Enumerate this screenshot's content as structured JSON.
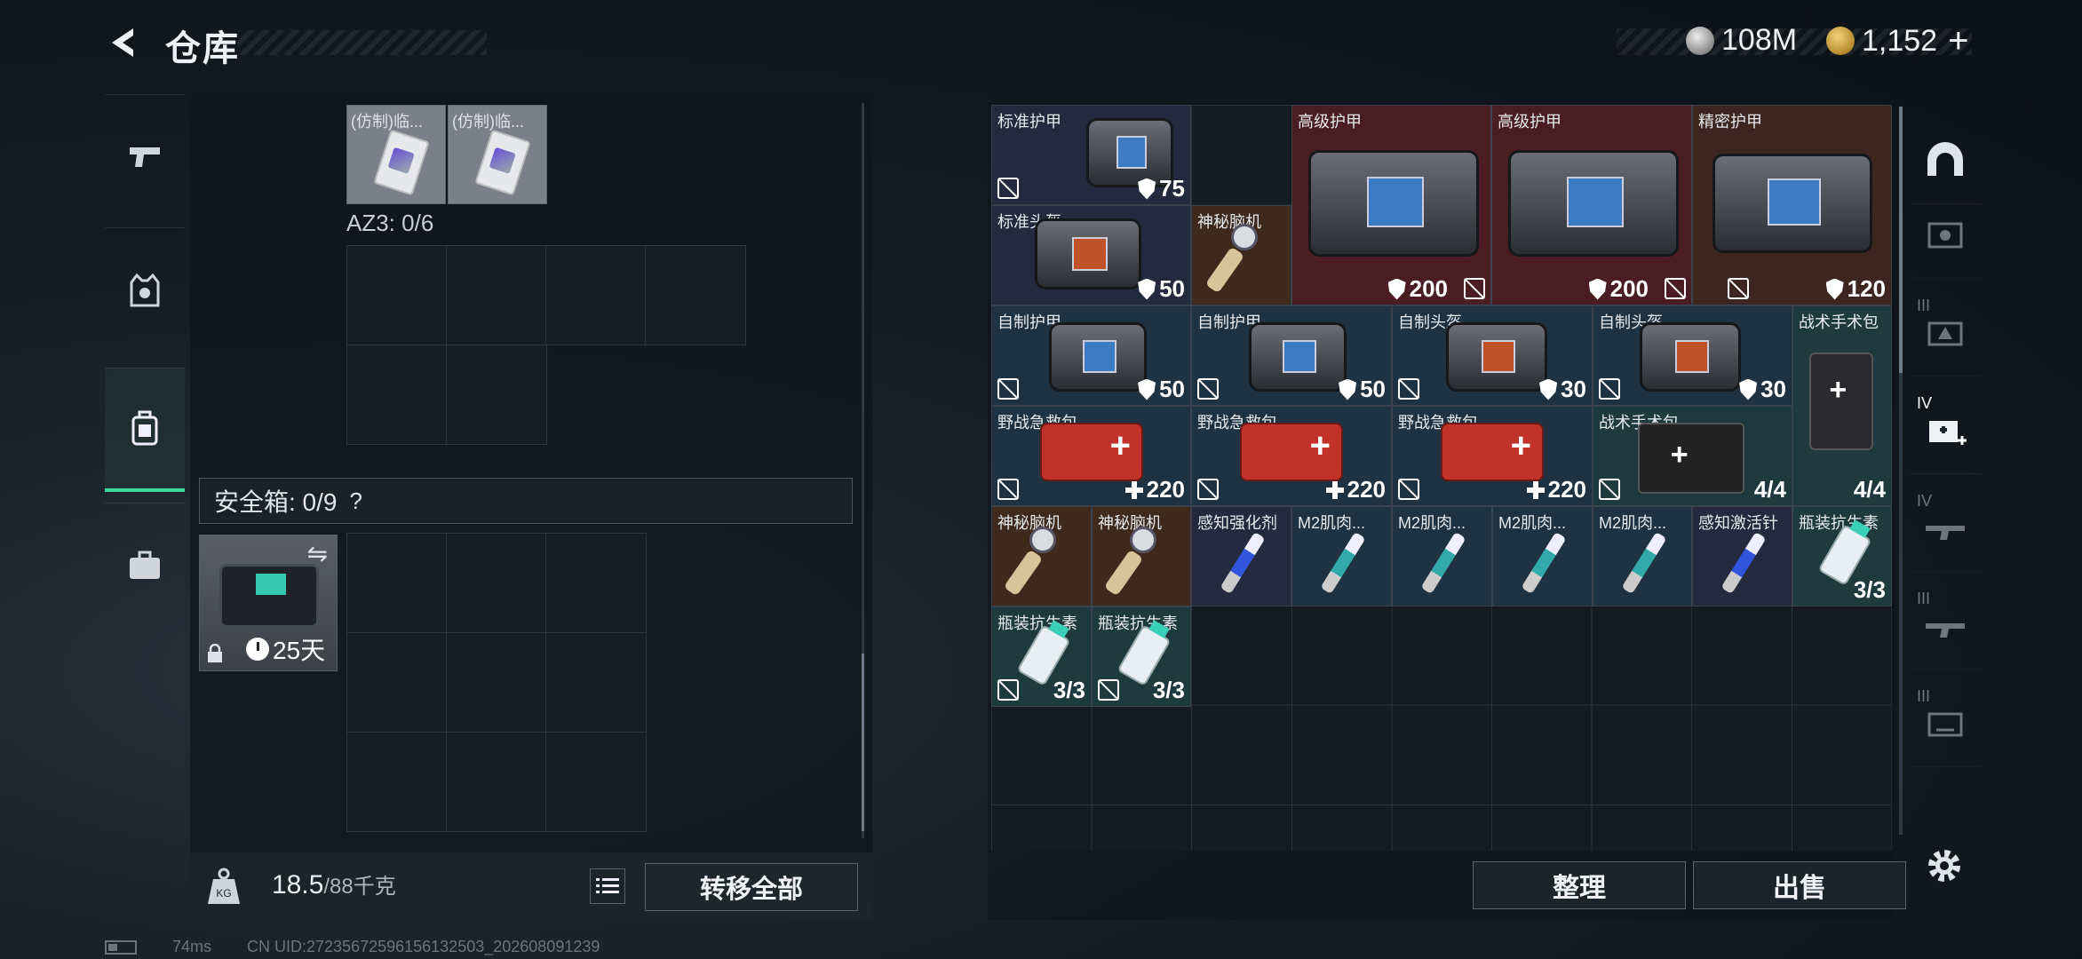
{
  "header": {
    "title": "仓库",
    "currency_silver": "108M",
    "currency_gold": "1,152",
    "add_label": "+"
  },
  "left": {
    "top_items": [
      {
        "name": "(仿制)临..."
      },
      {
        "name": "(仿制)临..."
      }
    ],
    "az3_label": "AZ3: 0/6",
    "safe_label": "安全箱: 0/9",
    "safe_help": "?",
    "safe_timer": "25天",
    "weight_value": "18.5",
    "weight_max": "/88千克",
    "transfer_label": "转移全部"
  },
  "stash": {
    "items": [
      {
        "name": "标准护甲",
        "value": "75",
        "type": "armor"
      },
      {
        "name": "高级护甲",
        "value": "200",
        "type": "armor"
      },
      {
        "name": "高级护甲",
        "value": "200",
        "type": "armor"
      },
      {
        "name": "精密护甲",
        "value": "120",
        "type": "armor"
      },
      {
        "name": "标准头盔",
        "value": "50",
        "type": "armor"
      },
      {
        "name": "神秘脑机",
        "value": "",
        "type": "misc"
      },
      {
        "name": "自制护甲",
        "value": "50",
        "type": "armor"
      },
      {
        "name": "自制护甲",
        "value": "50",
        "type": "armor"
      },
      {
        "name": "自制头盔",
        "value": "30",
        "type": "armor"
      },
      {
        "name": "自制头盔",
        "value": "30",
        "type": "armor"
      },
      {
        "name": "战术手术包",
        "value": "4/4",
        "type": "med"
      },
      {
        "name": "野战急救包",
        "value": "220",
        "type": "med"
      },
      {
        "name": "野战急救包",
        "value": "220",
        "type": "med"
      },
      {
        "name": "野战急救包",
        "value": "220",
        "type": "med"
      },
      {
        "name": "战术手术包",
        "value": "4/4",
        "type": "med"
      },
      {
        "name": "神秘脑机",
        "value": "",
        "type": "misc"
      },
      {
        "name": "神秘脑机",
        "value": "",
        "type": "misc"
      },
      {
        "name": "感知强化剂",
        "value": "",
        "type": "syringe"
      },
      {
        "name": "M2肌肉...",
        "value": "",
        "type": "syringe"
      },
      {
        "name": "M2肌肉...",
        "value": "",
        "type": "syringe"
      },
      {
        "name": "M2肌肉...",
        "value": "",
        "type": "syringe"
      },
      {
        "name": "M2肌肉...",
        "value": "",
        "type": "syringe"
      },
      {
        "name": "感知激活针",
        "value": "",
        "type": "syringe"
      },
      {
        "name": "瓶装抗生素",
        "value": "3/3",
        "type": "bottle"
      },
      {
        "name": "瓶装抗生素",
        "value": "3/3",
        "type": "bottle"
      },
      {
        "name": "瓶装抗生素",
        "value": "3/3",
        "type": "bottle"
      }
    ],
    "sort_label": "整理",
    "sell_label": "出售"
  },
  "tab_roman": [
    "III",
    "IV",
    "IV",
    "III",
    "III"
  ],
  "status": {
    "ping": "74ms",
    "uid": "CN UID:27235672596156132503_202608091239"
  },
  "colors": {
    "accent": "#3dd8a0",
    "advanced_bg": "#4a1d22",
    "precise_bg": "#3d2520",
    "standard_bg": "#232a3e",
    "homemade_bg": "#1e3242",
    "med_bg": "#1f3a3e",
    "rare_bg": "#3e2a1c"
  }
}
